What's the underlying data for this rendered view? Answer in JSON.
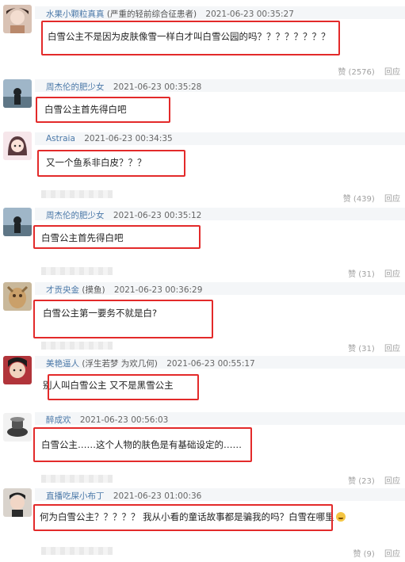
{
  "comments": [
    {
      "username": "水果小颗粒真真",
      "note": "(严重的轻前综合征患者)",
      "time": "2021-06-23 00:35:27",
      "text": "白雪公主不是因为皮肤像雪一样白才叫白雪公园的吗？？？？？？？？",
      "likes": "赞 (2576)",
      "reply": "回应"
    },
    {
      "username": "周杰伦的肥少女",
      "time": "2021-06-23 00:35:28",
      "text": "白雪公主首先得白吧"
    },
    {
      "username": "Astraia",
      "time": "2021-06-23 00:34:35",
      "text": "又一个鱼系非白皮？？？",
      "likes": "赞 (439)",
      "reply": "回应"
    },
    {
      "username": "周杰伦的肥少女",
      "time": "2021-06-23 00:35:12",
      "text": "白雪公主首先得白吧",
      "likes": "赞 (31)",
      "reply": "回应"
    },
    {
      "username": "才贡央金",
      "note": "(摸鱼)",
      "time": "2021-06-23 00:36:29",
      "text": "白雪公主第一要务不就是白?",
      "likes": "赞 (31)",
      "reply": "回应"
    },
    {
      "username": "美艳逼人",
      "note": "(浮生若梦 为欢几何)",
      "time": "2021-06-23 00:55:17",
      "text": "别人叫白雪公主 又不是黑雪公主"
    },
    {
      "username": "醉成欢",
      "time": "2021-06-23 00:56:03",
      "text": "白雪公主……这个人物的肤色是有基础设定的……",
      "likes": "赞 (23)",
      "reply": "回应"
    },
    {
      "username": "直播吃屎小布丁",
      "time": "2021-06-23 01:00:36",
      "text": "何为白雪公主？？？？？ 我从小看的童话故事都是骗我的吗？白雪在哪里",
      "likes": "赞 (9)",
      "reply": "回应"
    }
  ],
  "colors": {
    "accent": "#e32a2a",
    "username": "#4a78a8"
  }
}
